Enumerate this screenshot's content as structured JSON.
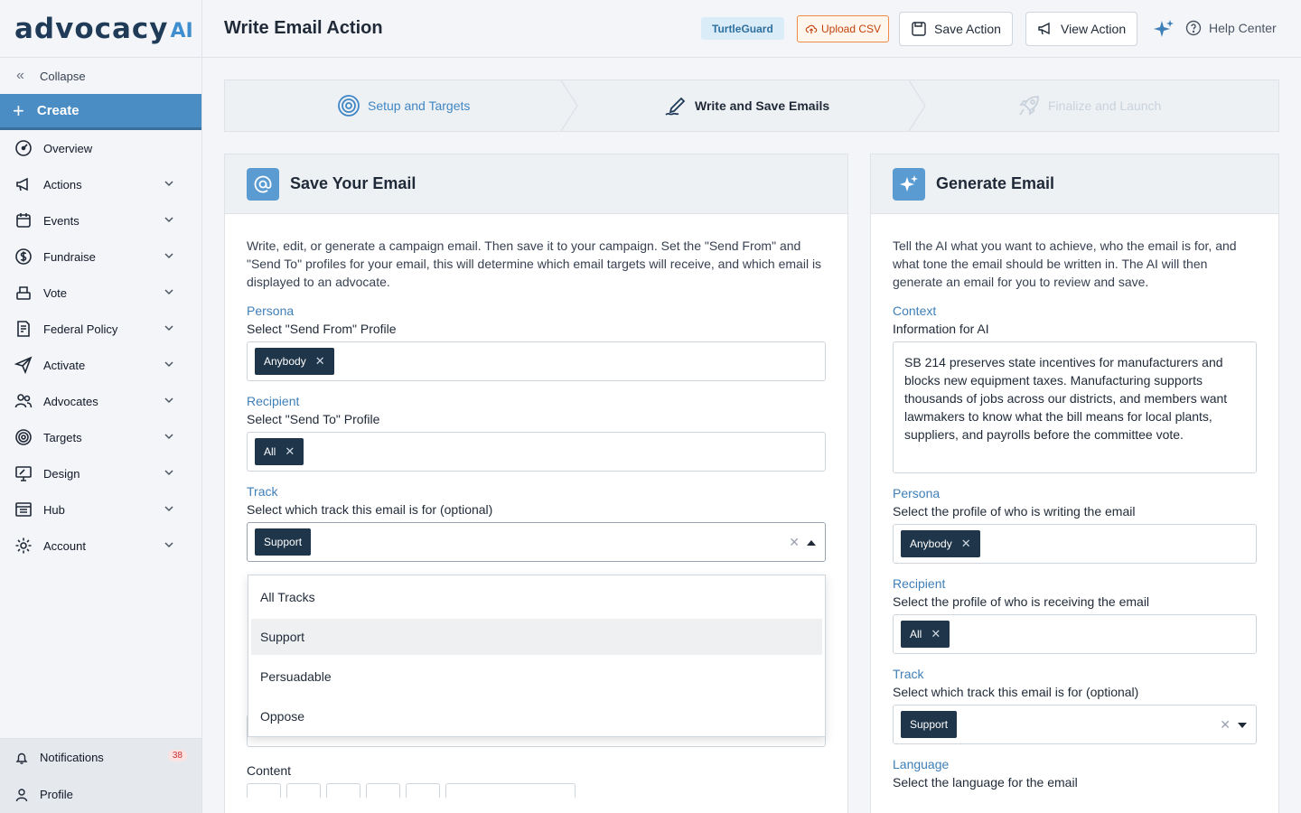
{
  "brand": {
    "word": "advocacy",
    "suffix": "AI"
  },
  "sidebar": {
    "collapse_label": "Collapse",
    "create_label": "Create",
    "items": [
      {
        "label": "Overview",
        "icon": "gauge-icon"
      },
      {
        "label": "Actions",
        "icon": "megaphone-icon"
      },
      {
        "label": "Events",
        "icon": "calendar-icon"
      },
      {
        "label": "Fundraise",
        "icon": "dollar-icon"
      },
      {
        "label": "Vote",
        "icon": "ballot-icon"
      },
      {
        "label": "Federal Policy",
        "icon": "policy-icon"
      },
      {
        "label": "Activate",
        "icon": "send-icon"
      },
      {
        "label": "Advocates",
        "icon": "people-icon"
      },
      {
        "label": "Targets",
        "icon": "target-icon"
      },
      {
        "label": "Design",
        "icon": "design-icon"
      },
      {
        "label": "Hub",
        "icon": "hub-icon"
      },
      {
        "label": "Account",
        "icon": "gear-icon"
      }
    ],
    "notifications_label": "Notifications",
    "notifications_count": "38",
    "profile_label": "Profile"
  },
  "header": {
    "title": "Write Email Action",
    "org_badge": "TurtleGuard",
    "upload_label": "Upload CSV",
    "save_label": "Save Action",
    "view_label": "View Action",
    "help_label": "Help Center"
  },
  "stepper": {
    "steps": [
      {
        "label": "Setup and Targets",
        "state": "done"
      },
      {
        "label": "Write and Save Emails",
        "state": "current"
      },
      {
        "label": "Finalize and Launch",
        "state": "upcoming"
      }
    ]
  },
  "save_card": {
    "title": "Save Your Email",
    "description": "Write, edit, or generate a campaign email. Then save it to your campaign. Set the \"Send From\" and \"Send To\" profiles for your email, this will determine which email targets will receive, and which email is displayed to an advocate.",
    "persona_label": "Persona",
    "persona_sub": "Select \"Send From\" Profile",
    "persona_value": "Anybody",
    "recipient_label": "Recipient",
    "recipient_sub": "Select \"Send To\" Profile",
    "recipient_value": "All",
    "track_label": "Track",
    "track_sub": "Select which track this email is for (optional)",
    "track_value": "Support",
    "track_options": [
      "All Tracks",
      "Support",
      "Persuadable",
      "Oppose"
    ],
    "track_selected_index": 1,
    "content_label": "Content"
  },
  "generate_card": {
    "title": "Generate Email",
    "description": "Tell the AI what you want to achieve, who the email is for, and what tone the email should be written in. The AI will then generate an email for you to review and save.",
    "context_label": "Context",
    "context_sub": "Information for AI",
    "context_value": "SB 214 preserves state incentives for manufacturers and blocks new equipment taxes. Manufacturing supports thousands of jobs across our districts, and members want lawmakers to know what the bill means for local plants, suppliers, and payrolls before the committee vote.",
    "persona_label": "Persona",
    "persona_sub": "Select the profile of who is writing the email",
    "persona_value": "Anybody",
    "recipient_label": "Recipient",
    "recipient_sub": "Select the profile of who is receiving the email",
    "recipient_value": "All",
    "track_label": "Track",
    "track_sub": "Select which track this email is for (optional)",
    "track_value": "Support",
    "language_label": "Language",
    "language_sub": "Select the language for the email"
  },
  "colors": {
    "accent": "#4a8cc4",
    "chip": "#1f3549",
    "label": "#3f7fb8",
    "upload": "#f08a4b"
  }
}
